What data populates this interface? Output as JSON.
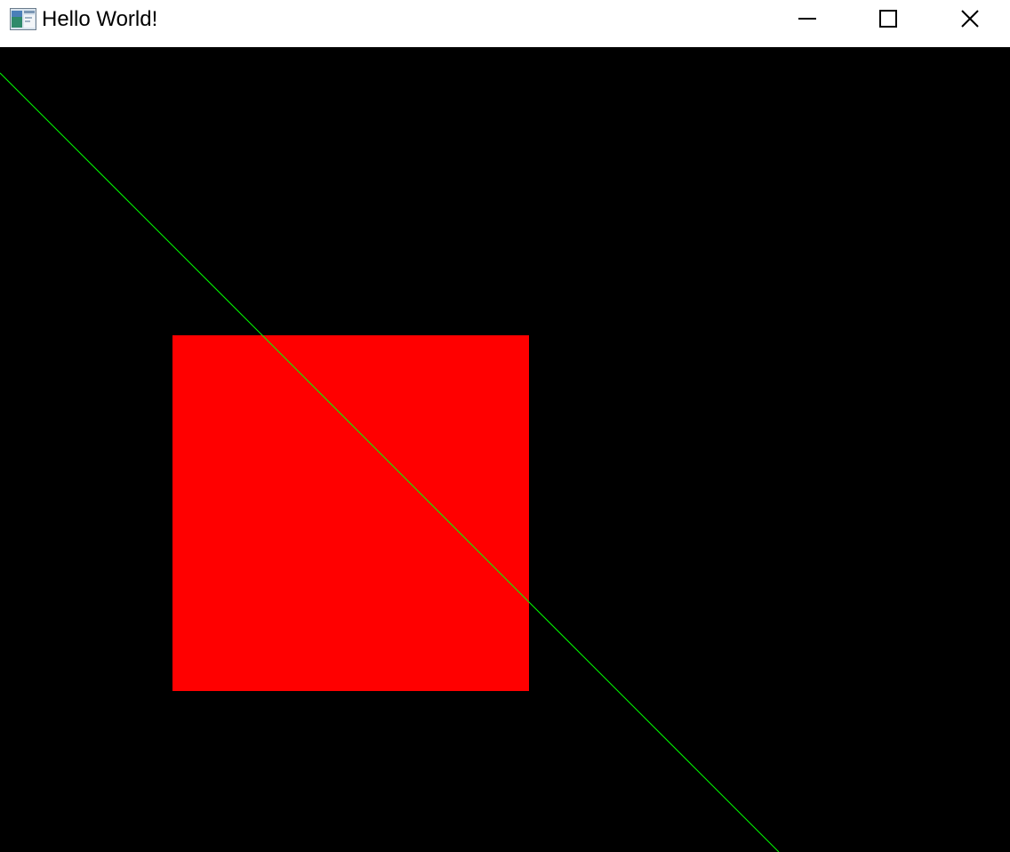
{
  "window": {
    "title": "Hello World!",
    "app_icon": "app-window-icon",
    "controls": {
      "minimize_icon": "minimize-icon",
      "maximize_icon": "maximize-icon",
      "close_icon": "close-icon"
    }
  },
  "canvas": {
    "background_color": "#000000",
    "rectangle_color": "#ff0000",
    "line_color": "#00ff00"
  }
}
